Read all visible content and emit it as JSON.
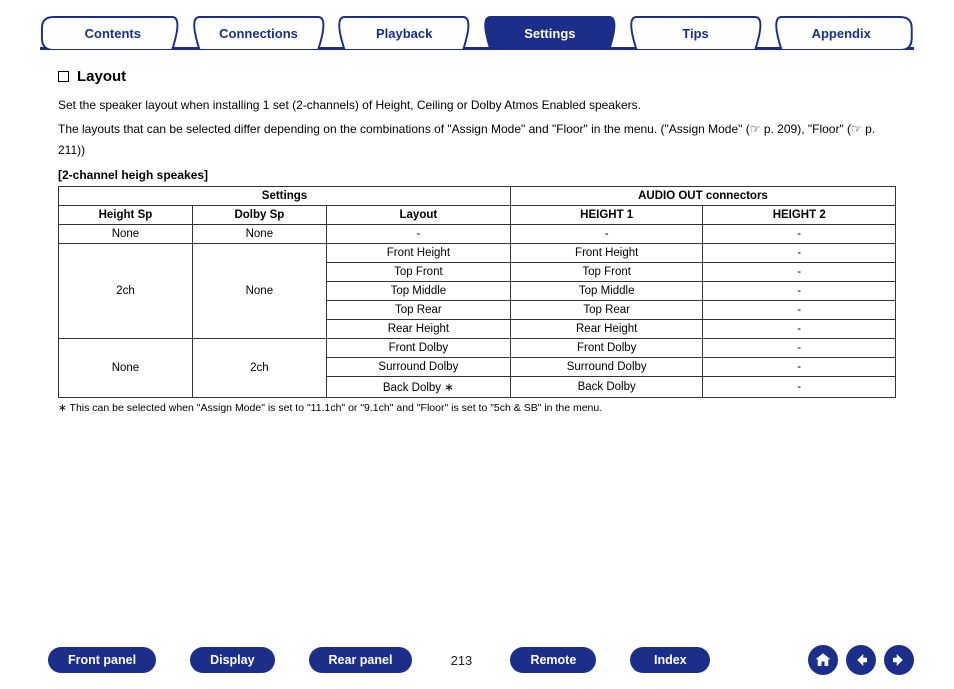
{
  "tabs": [
    {
      "label": "Contents",
      "active": false
    },
    {
      "label": "Connections",
      "active": false
    },
    {
      "label": "Playback",
      "active": false
    },
    {
      "label": "Settings",
      "active": true
    },
    {
      "label": "Tips",
      "active": false
    },
    {
      "label": "Appendix",
      "active": false
    }
  ],
  "section": {
    "title": "Layout",
    "p1": "Set the speaker layout when installing 1 set (2-channels) of Height, Ceiling or Dolby Atmos Enabled speakers.",
    "p2_a": "The layouts that can be selected differ depending on the combinations of \"Assign Mode\" and \"Floor\" in the menu. (\"Assign Mode\" (",
    "p2_b": " p. 209), \"Floor\" (",
    "p2_c": " p. 211))",
    "pointer": "☞",
    "subhead": "[2-channel heigh speakes]"
  },
  "table": {
    "group_settings": "Settings",
    "group_audio": "AUDIO OUT connectors",
    "col_height_sp": "Height Sp",
    "col_dolby_sp": "Dolby Sp",
    "col_layout": "Layout",
    "col_h1": "HEIGHT 1",
    "col_h2": "HEIGHT 2",
    "r1": {
      "hs": "None",
      "ds": "None",
      "layout": "-",
      "h1": "-",
      "h2": "-"
    },
    "g2": {
      "hs": "2ch",
      "ds": "None",
      "rows": [
        {
          "layout": "Front Height",
          "h1": "Front Height",
          "h2": "-"
        },
        {
          "layout": "Top Front",
          "h1": "Top Front",
          "h2": "-"
        },
        {
          "layout": "Top Middle",
          "h1": "Top Middle",
          "h2": "-"
        },
        {
          "layout": "Top Rear",
          "h1": "Top Rear",
          "h2": "-"
        },
        {
          "layout": "Rear Height",
          "h1": "Rear Height",
          "h2": "-"
        }
      ]
    },
    "g3": {
      "hs": "None",
      "ds": "2ch",
      "rows": [
        {
          "layout": "Front Dolby",
          "h1": "Front Dolby",
          "h2": "-"
        },
        {
          "layout": "Surround Dolby",
          "h1": "Surround Dolby",
          "h2": "-"
        },
        {
          "layout_pre": "Back Dolby ",
          "ast": "∗",
          "h1": "Back Dolby",
          "h2": "-"
        }
      ]
    }
  },
  "footnote": {
    "ast": "∗",
    "text": " This can be selected when \"Assign Mode\" is set to \"11.1ch\" or \"9.1ch\" and \"Floor\" is set to \"5ch & SB\" in the menu."
  },
  "bottom": {
    "front_panel": "Front panel",
    "display": "Display",
    "rear_panel": "Rear panel",
    "page": "213",
    "remote": "Remote",
    "index": "Index"
  }
}
